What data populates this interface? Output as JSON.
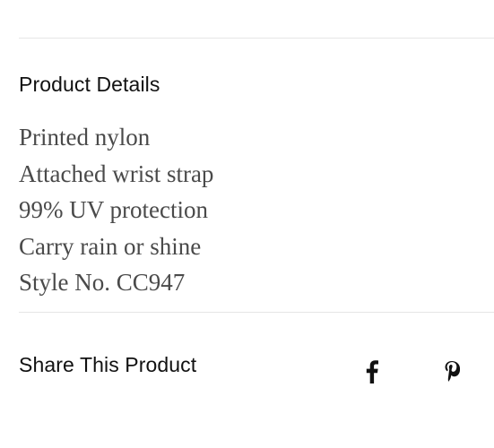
{
  "product_details": {
    "title": "Product Details",
    "items": [
      "Printed nylon",
      "Attached wrist strap",
      "99% UV protection",
      "Carry rain or shine",
      "Style No. CC947"
    ]
  },
  "share": {
    "title": "Share This Product",
    "icons": [
      {
        "name": "facebook-icon"
      },
      {
        "name": "pinterest-icon"
      }
    ]
  },
  "colors": {
    "text_primary": "#111111",
    "text_body": "#4a4a4a",
    "divider": "#e6e6e6"
  }
}
